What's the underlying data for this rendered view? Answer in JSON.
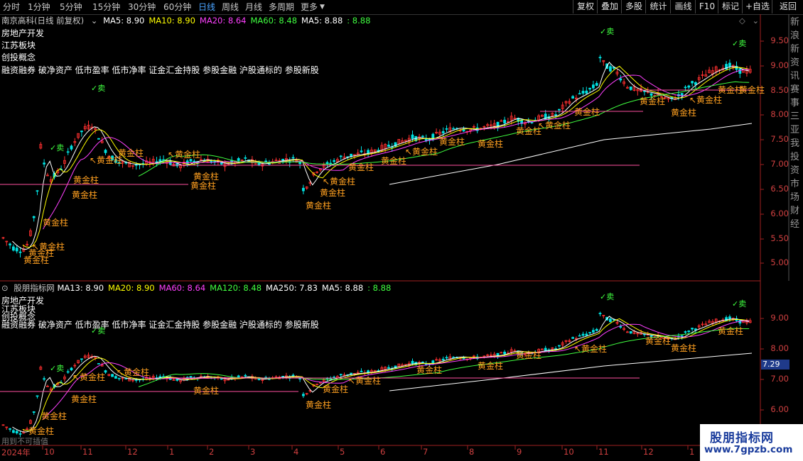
{
  "toolbar": {
    "timeframes": [
      "分时",
      "1分钟",
      "5分钟",
      "15分钟",
      "30分钟",
      "60分钟",
      "日线",
      "周线",
      "月线",
      "多周期",
      "更多"
    ],
    "active": "日线",
    "right_buttons": [
      "复权",
      "叠加",
      "多股",
      "统计",
      "画线",
      "F10",
      "标记",
      "+自选",
      "返回"
    ]
  },
  "main_panel": {
    "title": "南京高科(日线 前复权)",
    "ma_labels": [
      {
        "text": "MA5: 8.90",
        "color": "#ffffff"
      },
      {
        "text": "MA10: 8.90",
        "color": "#ffff00"
      },
      {
        "text": "MA20: 8.64",
        "color": "#ff40ff"
      },
      {
        "text": "MA60: 8.48",
        "color": "#40ff40"
      },
      {
        "text": "MA5: 8.88",
        "color": "#ffffff"
      },
      {
        "text": ": 8.88",
        "color": "#40ff40"
      }
    ],
    "categories": [
      "房地产开发",
      "江苏板块",
      "创投概念",
      "融资融券 破净资产 低市盈率 低市净率 证金汇金持股 参股金融 沪股通标的 参股新股"
    ],
    "y_ticks": [
      "9.50",
      "9.00",
      "8.50",
      "8.00",
      "7.50",
      "7.00",
      "6.50",
      "6.00",
      "5.50",
      "5.00"
    ]
  },
  "sub_panel": {
    "title": "股朋指标网",
    "ma_labels": [
      {
        "text": "MA13: 8.90",
        "color": "#ffffff"
      },
      {
        "text": "MA20: 8.90",
        "color": "#ffff00"
      },
      {
        "text": "MA60: 8.64",
        "color": "#ff40ff"
      },
      {
        "text": "MA120: 8.48",
        "color": "#40ff40"
      },
      {
        "text": "MA250: 7.83",
        "color": "#ffffff"
      },
      {
        "text": "MA5: 8.88",
        "color": "#ffffff"
      },
      {
        "text": ": 8.88",
        "color": "#40ff40"
      }
    ],
    "categories": [
      "房地产开发",
      "江苏板块",
      "创投概念",
      "融资融券 破净资产 低市盈率 低市净率 证金汇金持股 参股金融 沪股通标的 参股新股"
    ],
    "y_ticks": [
      "9.00",
      "8.00",
      "7.00",
      "6.00"
    ],
    "crosshair_value": "7.29"
  },
  "annotations": {
    "sell": "✓卖",
    "gold": "黄金柱",
    "gold_arrow": "↖黄金柱"
  },
  "right_strip_text": "新浪新资讯赛事三亚我投资市场财经",
  "x_axis": {
    "labels": [
      "2024年",
      "10",
      "11",
      "12",
      "1",
      "2",
      "3",
      "4",
      "5",
      "6",
      "7",
      "8",
      "9",
      "10",
      "11",
      "12",
      "1"
    ],
    "footer": "用到不可插值"
  },
  "watermark": {
    "line1": "股朋指标网",
    "line2": "www.7gpzb.com"
  },
  "colors": {
    "up": "#ff3030",
    "down": "#00e0e0",
    "gold": "#ffa020",
    "ma5": "#ffffff",
    "ma10": "#ffff00",
    "ma20": "#ff40ff",
    "ma60": "#40ff40",
    "axis": "#d04040"
  }
}
